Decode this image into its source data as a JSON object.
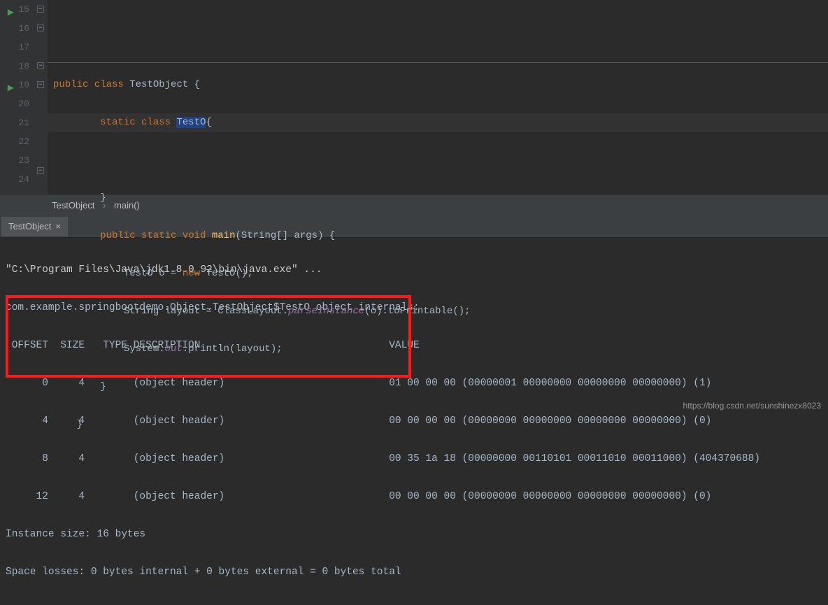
{
  "gutter": {
    "lines": [
      "15",
      "16",
      "17",
      "18",
      "19",
      "20",
      "21",
      "22",
      "23",
      "24"
    ]
  },
  "code": {
    "l15": {
      "kw1": "public ",
      "kw2": "class ",
      "name": "TestObject ",
      "brace": "{"
    },
    "l16": {
      "kw1": "static ",
      "kw2": "class ",
      "sel": "TestO",
      "brace": "{"
    },
    "l17": "",
    "l18": "}",
    "l19": {
      "kw1": "public static ",
      "kw2": "void ",
      "m": "main",
      "args": "(String[] args) {"
    },
    "l20": {
      "t": "TestO o = ",
      "n": "new ",
      "c": "TestO();"
    },
    "l21": {
      "a": "String layout = ClassLayout.",
      "m": "parseInstance",
      "b": "(o).toPrintable();"
    },
    "l22": {
      "a": "System.",
      "o": "out",
      "b": ".println(layout);"
    },
    "l23": "}",
    "l24": "}"
  },
  "breadcrumb": {
    "item1": "TestObject",
    "item2": "main()"
  },
  "tab": {
    "name": "TestObject"
  },
  "console": {
    "l1": "\"C:\\Program Files\\Java\\jdk1.8.0_92\\bin\\java.exe\" ...",
    "l2": "com.example.springbootdemo.Object.TestObject$TestO object internals:",
    "l3": " OFFSET  SIZE   TYPE DESCRIPTION                               VALUE",
    "l4": "      0     4        (object header)                           01 00 00 00 (00000001 00000000 00000000 00000000) (1)",
    "l5": "      4     4        (object header)                           00 00 00 00 (00000000 00000000 00000000 00000000) (0)",
    "l6": "      8     4        (object header)                           00 35 1a 18 (00000000 00110101 00011010 00011000) (404370688)",
    "l7": "     12     4        (object header)                           00 00 00 00 (00000000 00000000 00000000 00000000) (0)",
    "l8": "Instance size: 16 bytes",
    "l9": "Space losses: 0 bytes internal + 0 bytes external = 0 bytes total"
  },
  "watermark": "https://blog.csdn.net/sunshinezx8023"
}
